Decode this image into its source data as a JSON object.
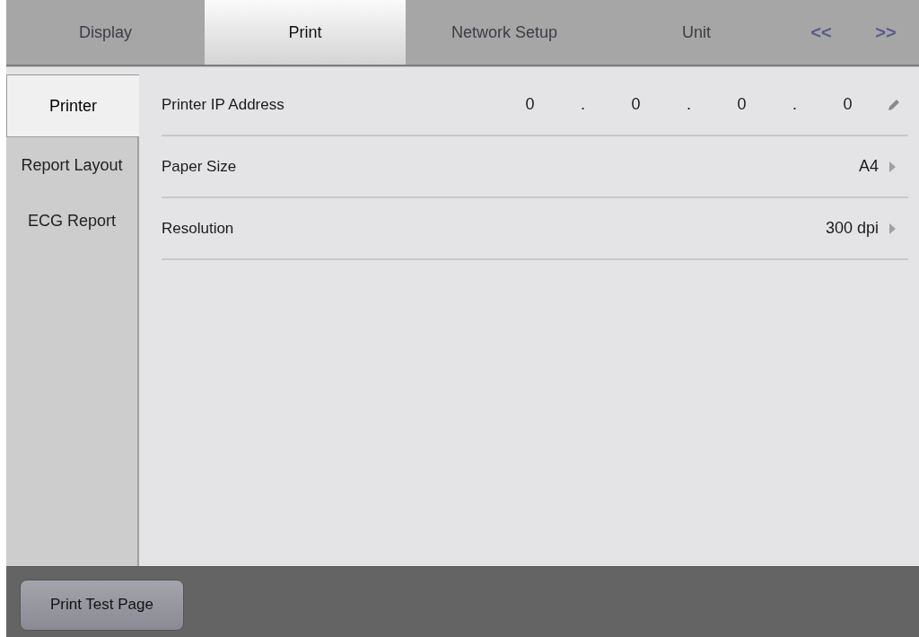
{
  "tabs": [
    {
      "label": "Display",
      "selected": false
    },
    {
      "label": "Print",
      "selected": true
    },
    {
      "label": "Network Setup",
      "selected": false
    },
    {
      "label": "Unit",
      "selected": false
    }
  ],
  "tab_arrows": [
    "<<",
    ">>"
  ],
  "sidebar": {
    "items": [
      {
        "label": "Printer",
        "selected": true
      },
      {
        "label": "Report Layout",
        "selected": false
      },
      {
        "label": "ECG Report",
        "selected": false
      }
    ]
  },
  "settings": [
    {
      "kind": "ip",
      "label": "Printer IP Address",
      "parts": [
        "0",
        ".",
        "0",
        ".",
        "0",
        ".",
        "0"
      ]
    },
    {
      "kind": "select",
      "label": "Paper Size",
      "value": "A4"
    },
    {
      "kind": "select",
      "label": "Resolution",
      "value": "300 dpi"
    }
  ],
  "footer": {
    "buttons": [
      "Print Test Page"
    ]
  }
}
